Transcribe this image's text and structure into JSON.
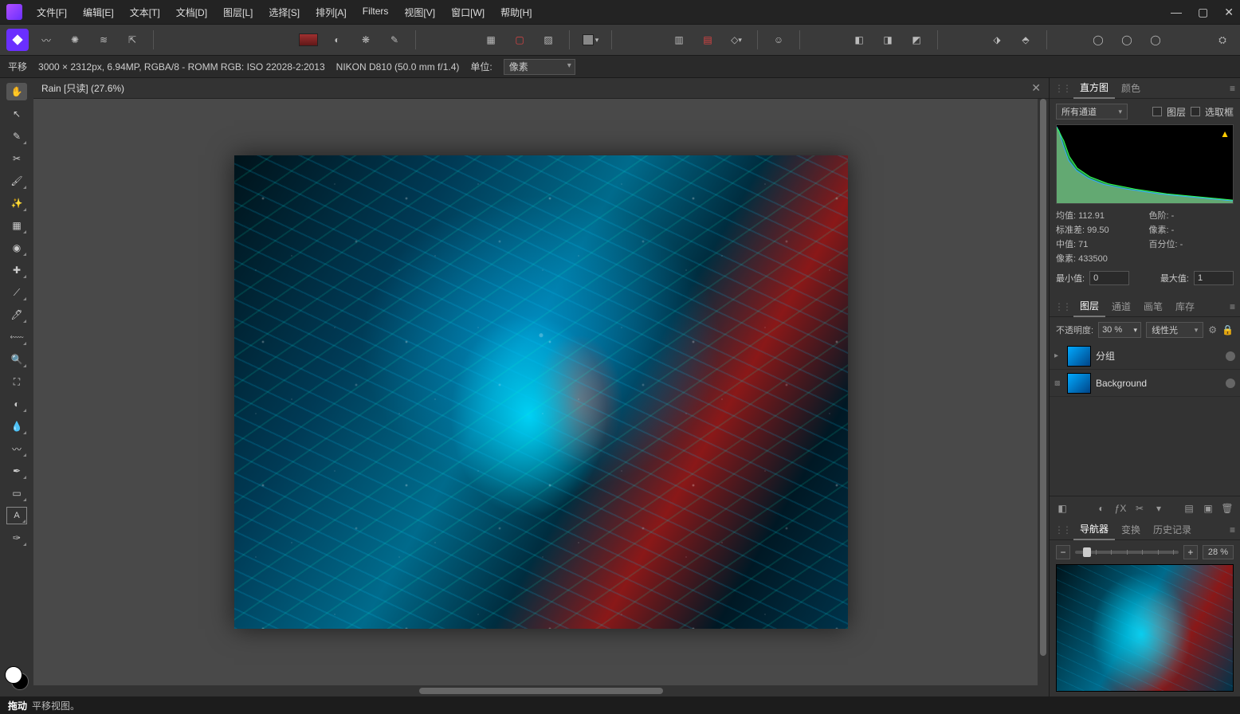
{
  "menu": {
    "file": "文件[F]",
    "edit": "编辑[E]",
    "text": "文本[T]",
    "document": "文档[D]",
    "layer": "图层[L]",
    "select": "选择[S]",
    "arrange": "排列[A]",
    "filters": "Filters",
    "view": "视图[V]",
    "window": "窗口[W]",
    "help": "帮助[H]"
  },
  "context": {
    "tool": "平移",
    "info": "3000 × 2312px, 6.94MP, RGBA/8 - ROMM RGB: ISO 22028-2:2013",
    "camera": "NIKON D810 (50.0 mm f/1.4)",
    "unit_label": "单位:",
    "unit_value": "像素"
  },
  "doc": {
    "title": "Rain [只读] (27.6%)"
  },
  "panels": {
    "histogram": {
      "tab1": "直方图",
      "tab2": "颜色",
      "channel": "所有通道",
      "layer_label": "图层",
      "sel_label": "选取框",
      "mean_k": "均值:",
      "mean_v": "112.91",
      "std_k": "标准差:",
      "std_v": "99.50",
      "median_k": "中值:",
      "median_v": "71",
      "pixels_k": "像素:",
      "pixels_v": "433500",
      "range_k": "色阶:",
      "range_v": "-",
      "pixsel_k": "像素:",
      "pixsel_v": "-",
      "pct_k": "百分位:",
      "pct_v": "-",
      "min_label": "最小值:",
      "min_v": "0",
      "max_label": "最大值:",
      "max_v": "1"
    },
    "layers": {
      "tab1": "图层",
      "tab2": "通道",
      "tab3": "画笔",
      "tab4": "库存",
      "opacity_label": "不透明度:",
      "opacity_value": "30 %",
      "blend": "线性光",
      "row1": "分组",
      "row2": "Background"
    },
    "nav": {
      "tab1": "导航器",
      "tab2": "变换",
      "tab3": "历史记录",
      "zoom": "28 %"
    }
  },
  "status": {
    "bold": "拖动",
    "text": "平移视图。"
  }
}
